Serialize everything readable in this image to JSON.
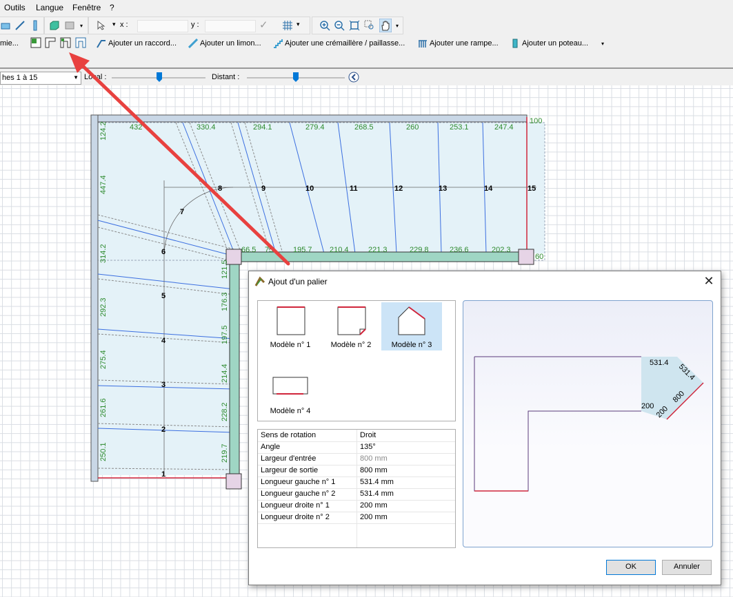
{
  "menu": [
    "Outils",
    "Langue",
    "Fenêtre",
    "?"
  ],
  "toolbar1": {
    "x_label": "x :",
    "y_label": "y :",
    "x_value": "",
    "y_value": ""
  },
  "toolbar2": {
    "cut_label": "mie...",
    "buttons": [
      "Ajouter un raccord...",
      "Ajouter un limon...",
      "Ajouter une crémaillère / paillasse...",
      "Ajouter une rampe...",
      "Ajouter un poteau..."
    ]
  },
  "toolbar3": {
    "range_select": "hes 1 à 15",
    "local_label": "Local :",
    "distant_label": "Distant :"
  },
  "drawing": {
    "top_dims": [
      "432",
      "330.4",
      "294.1",
      "279.4",
      "268.5",
      "260",
      "253.1",
      "247.4",
      "100"
    ],
    "left_dims": [
      "124.2",
      "447.4",
      "314.2",
      "292.3",
      "275.4",
      "261.6",
      "250.1"
    ],
    "mid_dims": [
      "66.5",
      "75",
      "195.7",
      "210.4",
      "221.3",
      "229.8",
      "236.6",
      "202.3",
      "60"
    ],
    "vert_dims": [
      "121.5",
      "176.3",
      "197.5",
      "214.4",
      "228.2",
      "219.7"
    ],
    "step_numbers": [
      "1",
      "2",
      "3",
      "4",
      "5",
      "6",
      "7",
      "8",
      "9",
      "10",
      "11",
      "12",
      "13",
      "14",
      "15"
    ]
  },
  "dialog": {
    "title": "Ajout d'un palier",
    "close": "✕",
    "models": [
      {
        "label": "Modèle n° 1",
        "selected": false
      },
      {
        "label": "Modèle n° 2",
        "selected": false
      },
      {
        "label": "Modèle n° 3",
        "selected": true
      },
      {
        "label": "Modèle n° 4",
        "selected": false
      }
    ],
    "properties": [
      {
        "key": "Sens de rotation",
        "value": "Droit"
      },
      {
        "key": "Angle",
        "value": "135°"
      },
      {
        "key": "Largeur d'entrée",
        "value": "800 mm",
        "disabled": true
      },
      {
        "key": "Largeur de sortie",
        "value": "800 mm"
      },
      {
        "key": "Longueur gauche n° 1",
        "value": "531.4 mm"
      },
      {
        "key": "Longueur gauche n° 2",
        "value": "531.4 mm"
      },
      {
        "key": "Longueur droite n° 1",
        "value": "200 mm"
      },
      {
        "key": "Longueur droite n° 2",
        "value": "200 mm"
      }
    ],
    "preview_labels": [
      "531.4",
      "531.4",
      "800",
      "200",
      "200"
    ],
    "ok": "OK",
    "cancel": "Annuler"
  },
  "colors": {
    "dim_green": "#2d8a2d",
    "accent_red": "#d0243a",
    "selection_blue": "#cce4f7",
    "stair_fill": "#e4f2f8",
    "rail_green": "#9fd6c4",
    "arrow_red": "#e8413f"
  }
}
